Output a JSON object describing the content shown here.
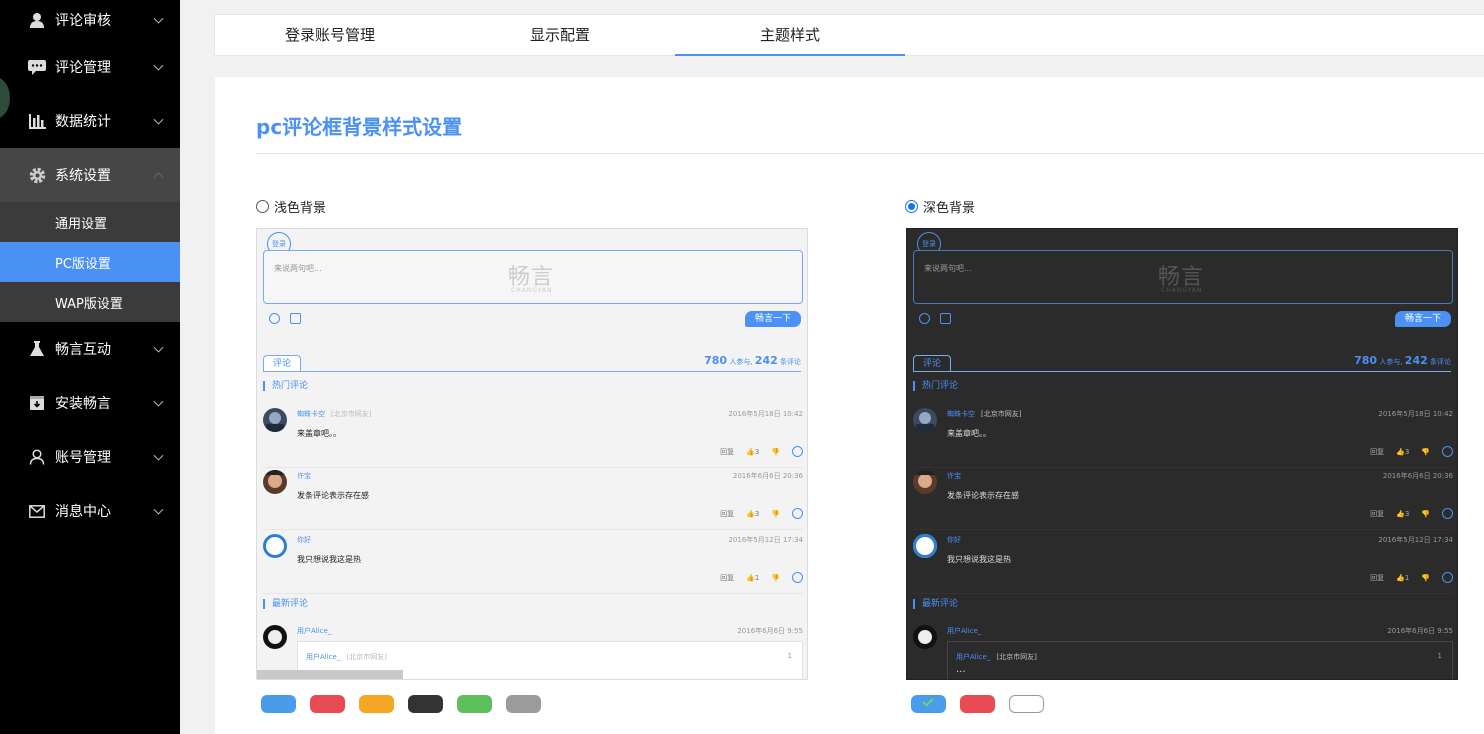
{
  "sidebar": {
    "items": [
      {
        "label": "评论审核",
        "icon": "user-icon"
      },
      {
        "label": "评论管理",
        "icon": "comment-icon"
      },
      {
        "label": "数据统计",
        "icon": "bar-chart-icon"
      },
      {
        "label": "系统设置",
        "icon": "gear-icon",
        "open": true,
        "children": [
          {
            "label": "通用设置"
          },
          {
            "label": "PC版设置",
            "active": true
          },
          {
            "label": "WAP版设置"
          }
        ]
      },
      {
        "label": "畅言互动",
        "icon": "flask-icon"
      },
      {
        "label": "安装畅言",
        "icon": "download-box-icon"
      },
      {
        "label": "账号管理",
        "icon": "person-outline-icon"
      },
      {
        "label": "消息中心",
        "icon": "mail-icon"
      }
    ]
  },
  "tabs": [
    {
      "label": "登录账号管理"
    },
    {
      "label": "显示配置"
    },
    {
      "label": "主题样式",
      "active": true
    }
  ],
  "panel": {
    "title": "pc评论框背景样式设置",
    "options": [
      {
        "label": "浅色背景",
        "checked": false
      },
      {
        "label": "深色背景",
        "checked": true
      }
    ]
  },
  "preview": {
    "login": "登录",
    "placeholder": "来说两句吧...",
    "watermark": "畅言",
    "watermark_sub": "CHANGYAN",
    "submit": "畅言一下",
    "tab": "评论",
    "count_join": "780",
    "count_join_label": "人参与,",
    "count_comment": "242",
    "count_comment_label": "条评论",
    "hot_title": "热门评论",
    "new_title": "最新评论",
    "reply_label": "回复",
    "comments": [
      {
        "name": "蜘蛛卡空",
        "location_light": "[北京市网友]",
        "location_dark": "[北京市网友]",
        "time": "2016年5月18日 10:42",
        "text": "来盖章吧。。",
        "likes": "3"
      },
      {
        "name": "许宝",
        "time": "2016年6月6日 20:36",
        "text": "发条评论表示存在感",
        "likes": "3"
      },
      {
        "name": "你好",
        "time": "2016年5月12日 17:34",
        "text": "我只想说我这是热",
        "likes": "1"
      }
    ],
    "new_comment": {
      "name": "用户Alice_",
      "time": "2016年6月6日 9:55",
      "reply_name": "用户Alice_",
      "reply_loc": "[北京市网友]",
      "reply_count": "1",
      "more": "..."
    }
  },
  "swatches": {
    "light": [
      "#4a9be9",
      "#e84b54",
      "#f5a623",
      "#333333",
      "#5cbf5c",
      "#9b9b9b"
    ],
    "dark": [
      {
        "color": "#4a9be9",
        "selected": true
      },
      {
        "color": "#e84b54",
        "selected": false
      },
      {
        "color": "#ffffff",
        "selected": false
      }
    ]
  }
}
